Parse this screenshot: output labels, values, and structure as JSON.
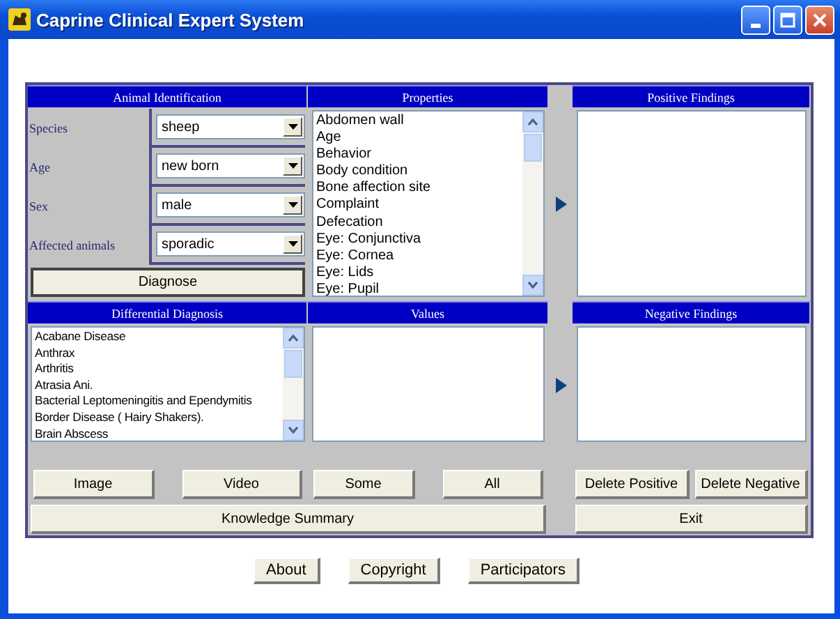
{
  "window": {
    "title": "Caprine Clinical Expert System"
  },
  "animal_identification": {
    "title": "Animal Identification",
    "fields": [
      {
        "label": "Species",
        "value": "sheep"
      },
      {
        "label": "Age",
        "value": "new born"
      },
      {
        "label": "Sex",
        "value": "male"
      },
      {
        "label": "Affected animals",
        "value": "sporadic"
      }
    ],
    "diagnose_button": "Diagnose"
  },
  "properties": {
    "title": "Properties",
    "items": [
      "Abdomen wall",
      "Age",
      "Behavior",
      "Body condition",
      "Bone affection site",
      "Complaint",
      "Defecation",
      "Eye: Conjunctiva",
      "Eye: Cornea",
      "Eye: Lids",
      "Eye: Pupil"
    ]
  },
  "positive_findings": {
    "title": "Positive Findings"
  },
  "differential_diagnosis": {
    "title": "Differential Diagnosis",
    "items": [
      "Acabane Disease",
      "Anthrax",
      "Arthritis",
      "Atrasia Ani.",
      "Bacterial Leptomeningitis and Ependymitis",
      "Border Disease ( Hairy Shakers).",
      "Brain Abscess"
    ],
    "buttons": [
      "Image",
      "Video"
    ]
  },
  "values": {
    "title": "Values",
    "buttons": [
      "Some",
      "All"
    ]
  },
  "negative_findings": {
    "title": "Negative Findings",
    "buttons": [
      "Delete Positive",
      "Delete Negative"
    ]
  },
  "knowledge_summary_button": "Knowledge Summary",
  "exit_button": "Exit",
  "footer_buttons": [
    "About",
    "Copyright",
    "Participators"
  ]
}
